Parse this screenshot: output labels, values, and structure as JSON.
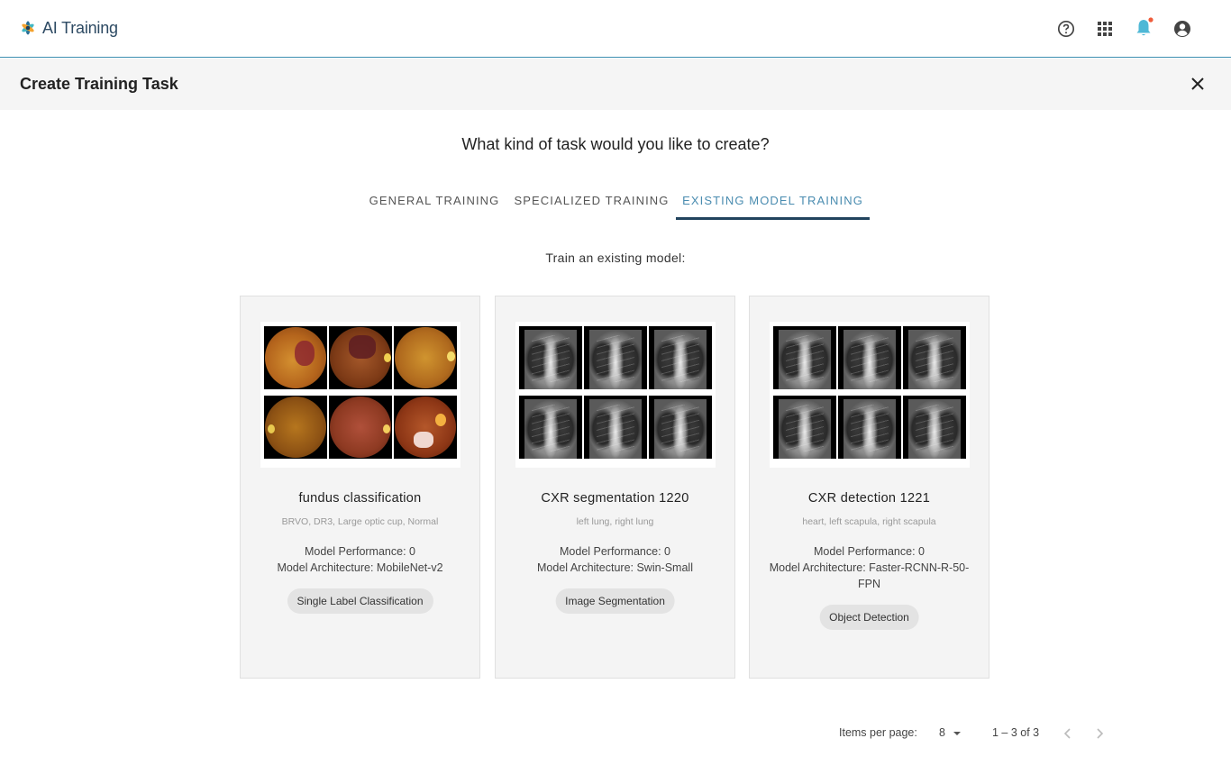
{
  "app": {
    "title": "AI Training"
  },
  "topbar": {
    "icons": [
      "help-circle-icon",
      "apps-grid-icon",
      "notification-bell-icon",
      "account-circle-icon"
    ],
    "accent": "#3d8fb0",
    "notification_color": "#4fb8d6",
    "notification_dot_color": "#ef5c3b"
  },
  "header": {
    "title": "Create Training Task"
  },
  "main": {
    "question": "What kind of task would you like to create?",
    "tabs": [
      {
        "label": "GENERAL TRAINING",
        "active": false
      },
      {
        "label": "SPECIALIZED TRAINING",
        "active": false
      },
      {
        "label": "EXISTING MODEL TRAINING",
        "active": true
      }
    ],
    "instruction": "Train an existing model:",
    "cards": [
      {
        "title": "fundus classification",
        "labels": "BRVO, DR3, Large optic cup, Normal",
        "performance": "Model Performance: 0",
        "architecture": "Model Architecture: MobileNet-v2",
        "type": "Single Label Classification",
        "image_kind": "fundus-retina-images"
      },
      {
        "title": "CXR segmentation 1220",
        "labels": "left lung, right lung",
        "performance": "Model Performance: 0",
        "architecture": "Model Architecture: Swin-Small",
        "type": "Image Segmentation",
        "image_kind": "chest-xray-images"
      },
      {
        "title": "CXR detection 1221",
        "labels": "heart, left scapula, right scapula",
        "performance": "Model Performance: 0",
        "architecture": "Model Architecture: Faster-RCNN-R-50-FPN",
        "type": "Object Detection",
        "image_kind": "chest-xray-images"
      }
    ]
  },
  "pagination": {
    "items_per_page_label": "Items per page:",
    "items_per_page": "8",
    "range": "1 – 3 of 3"
  }
}
